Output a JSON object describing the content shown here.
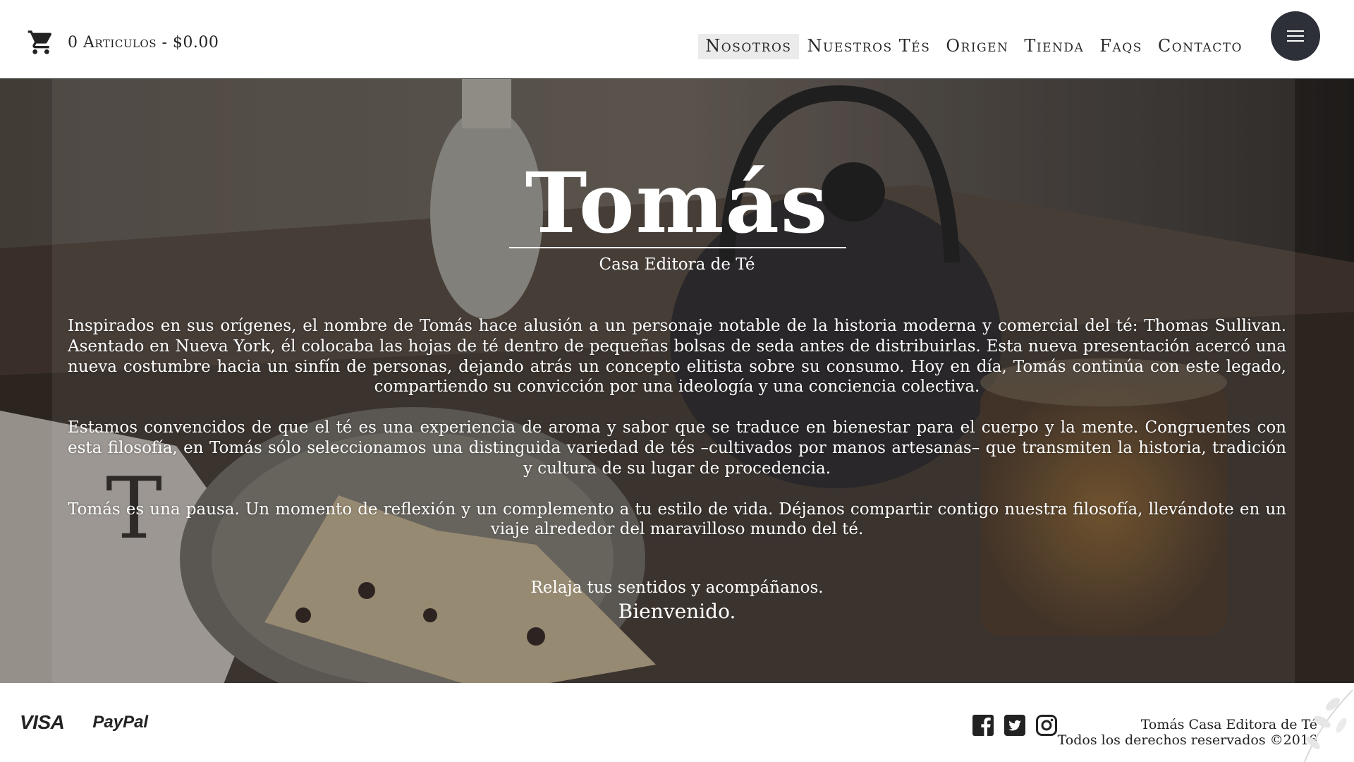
{
  "header": {
    "cart": {
      "count": "0",
      "label": "Artículos",
      "total": "$0.00",
      "icon": "cart-icon"
    },
    "cart_text": "0 Articulos - $0.00",
    "nav": [
      {
        "label": "Nosotros",
        "active": true
      },
      {
        "label": "Nuestros Tés",
        "active": false
      },
      {
        "label": "Origen",
        "active": false
      },
      {
        "label": "Tienda",
        "active": false
      },
      {
        "label": "Faqs",
        "active": false
      },
      {
        "label": "Contacto",
        "active": false
      }
    ],
    "menu_icon": "hamburger-icon"
  },
  "hero": {
    "brand": "Tomás",
    "subtitle": "Casa Editora de Té",
    "paragraphs": [
      "Inspirados en sus orígenes, el nombre de Tomás hace alusión a un personaje notable de la historia moderna y comercial del té: Thomas Sullivan. Asentado en Nueva York, él colocaba las hojas de té dentro de pequeñas bolsas de seda antes de distribuirlas. Esta nueva presentación acercó una nueva costumbre hacia un sinfín de personas, dejando atrás un concepto elitista sobre su consumo. Hoy en día, Tomás continúa con este legado, compartiendo su convicción por una ideología y una conciencia colectiva.",
      "Estamos convencidos de que el té es una experiencia de aroma y sabor que se traduce en bienestar para el cuerpo y la mente. Congruentes con esta filosofía, en Tomás sólo seleccionamos una distinguida variedad de tés –cultivados por manos artesanas– que transmiten la historia, tradición y cultura de su lugar de procedencia.",
      "Tomás es una pausa. Un momento de reflexión y un complemento a tu estilo de vida. Déjanos compartir contigo nuestra filosofía, llevándote en un viaje alrededor del maravilloso mundo del té."
    ],
    "closing_line1": "Relaja tus sentidos y acompáñanos.",
    "closing_line2": "Bienvenido."
  },
  "footer": {
    "payments": {
      "visa": "VISA",
      "paypal": "PayPal"
    },
    "social": [
      "facebook-icon",
      "twitter-icon",
      "instagram-icon"
    ],
    "copyright_line1": "Tomás Casa Editora de Té",
    "copyright_line2": "Todos los derechos reservados ©2016"
  },
  "colors": {
    "menu_button": "#2d3038",
    "active_nav_bg": "#ebebeb",
    "text": "#2b2b2b"
  }
}
